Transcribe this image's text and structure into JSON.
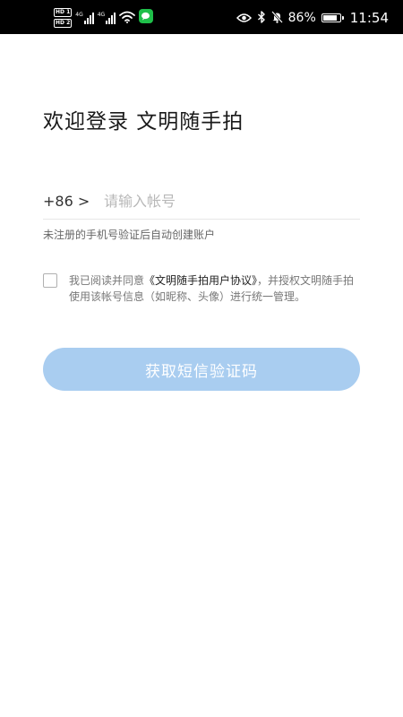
{
  "status_bar": {
    "sim1_badge": "HD 1",
    "sim2_badge": "HD 2",
    "sim1_network": "4G",
    "sim2_network": "4G",
    "icons": [
      "eye-icon",
      "bluetooth-icon",
      "mute-bell-icon",
      "wifi-icon",
      "wechat-icon",
      "battery-icon"
    ],
    "battery_percent_text": "86%",
    "battery_level": 0.86,
    "time": "11:54"
  },
  "login": {
    "title": "欢迎登录 文明随手拍",
    "country_code": "+86 >",
    "phone_placeholder": "请输入帐号",
    "phone_value": "",
    "hint": "未注册的手机号验证后自动创建账户",
    "agreement": {
      "checked": false,
      "prefix": "我已阅读并同意",
      "link": "《文明随手拍用户协议》",
      "suffix": "，并授权文明随手拍使用该帐号信息（如昵称、头像）进行统一管理。"
    },
    "submit_button": "获取短信验证码"
  },
  "colors": {
    "button_bg": "#a9cdf0",
    "button_text": "#ffffff",
    "status_bar_bg": "#000000",
    "page_bg": "#ffffff"
  }
}
